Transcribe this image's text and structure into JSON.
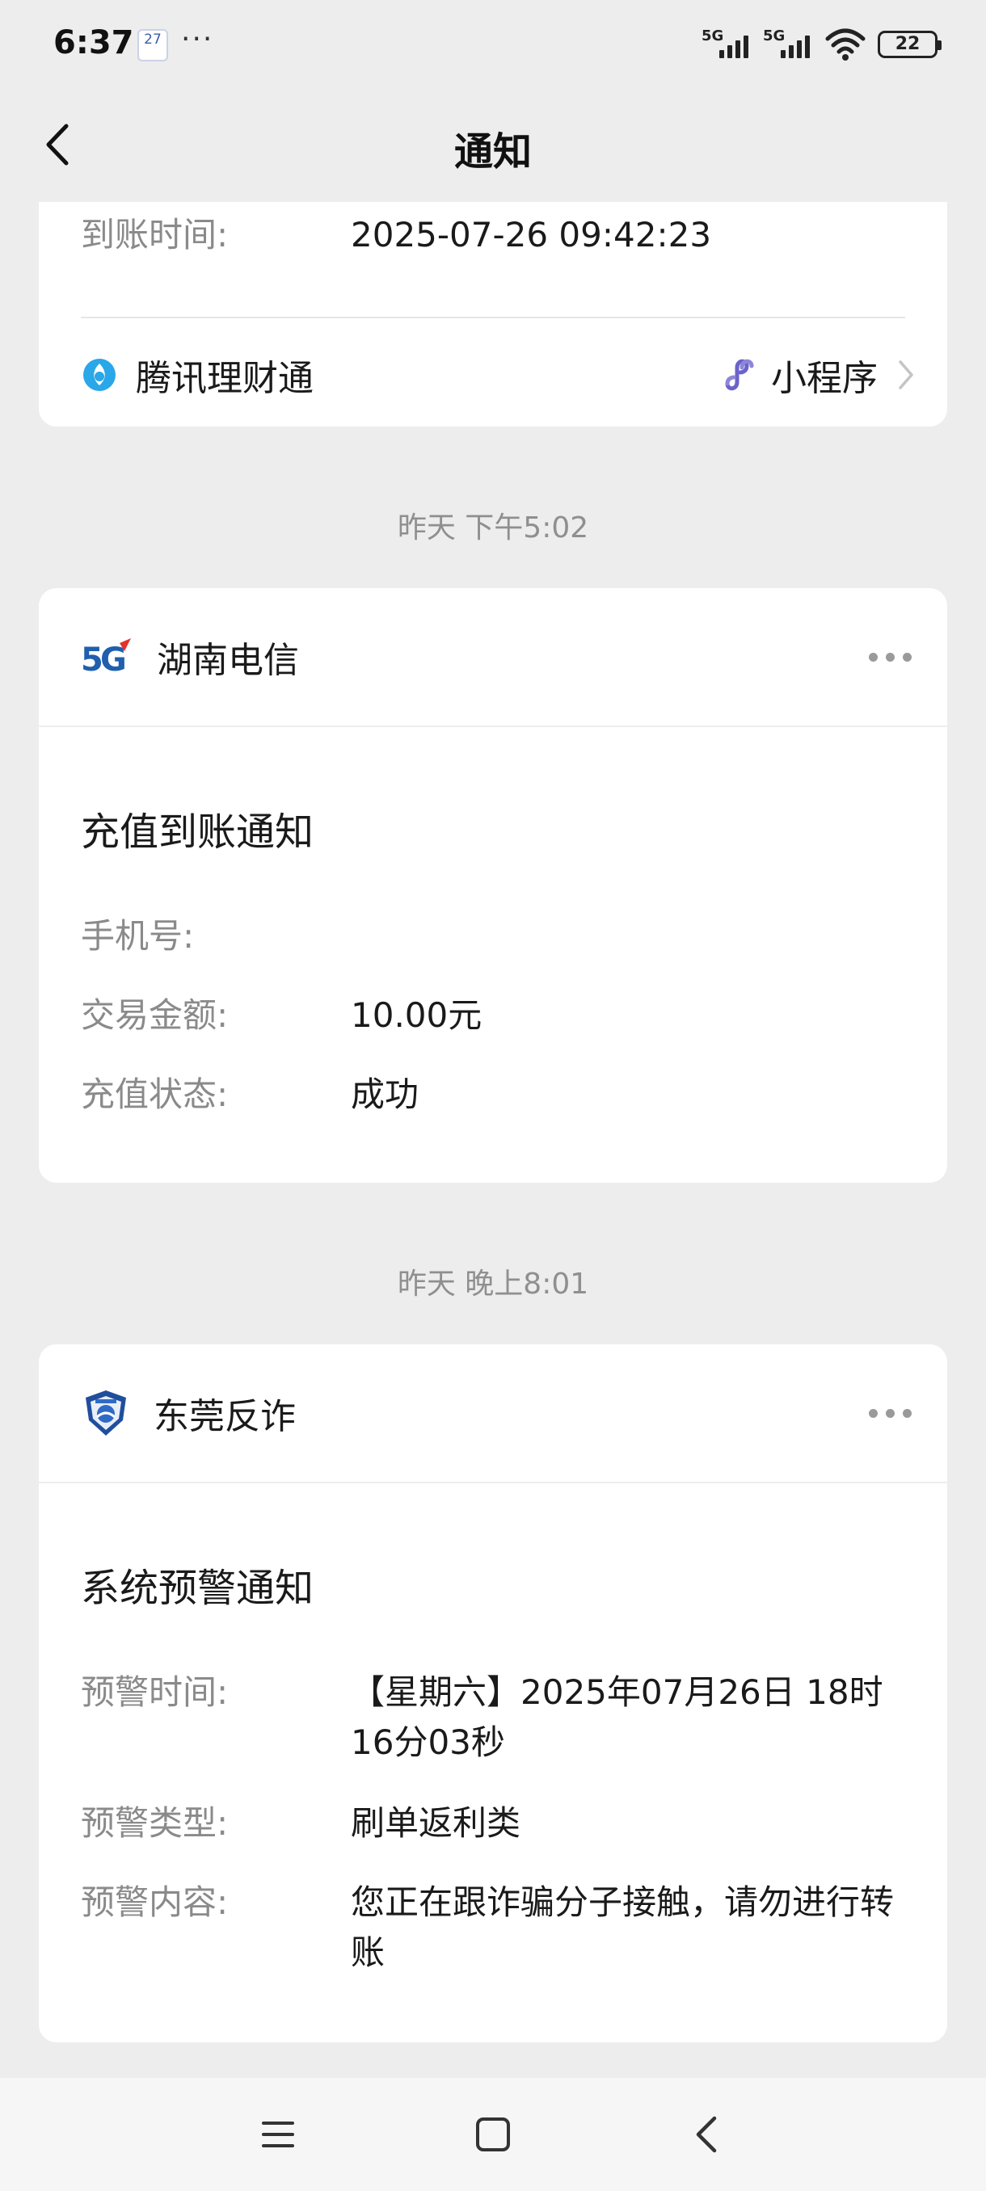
{
  "status_bar": {
    "time": "6:37",
    "calendar_day": "27",
    "more": "···",
    "signal1_label": "5G",
    "signal2_label": "5G",
    "battery": "22"
  },
  "nav": {
    "title": "通知"
  },
  "card_licaitong": {
    "arrival_label": "到账时间:",
    "arrival_value": "2025-07-26 09:42:23",
    "source_name": "腾讯理财通",
    "mini_program_label": "小程序"
  },
  "timestamp_1": "昨天 下午5:02",
  "card_telecom": {
    "account_name": "湖南电信",
    "title": "充值到账通知",
    "rows": [
      {
        "label": "手机号:",
        "value": ""
      },
      {
        "label": "交易金额:",
        "value": "10.00元"
      },
      {
        "label": "充值状态:",
        "value": "成功"
      }
    ]
  },
  "timestamp_2": "昨天 晚上8:01",
  "card_police": {
    "account_name": "东莞反诈",
    "title": "系统预警通知",
    "rows": [
      {
        "label": "预警时间:",
        "value": "【星期六】2025年07月26日 18时16分03秒"
      },
      {
        "label": "预警类型:",
        "value": "刷单返利类"
      },
      {
        "label": "预警内容:",
        "value": "您正在跟诈骗分子接触，请勿进行转账"
      }
    ]
  },
  "colors": {
    "background": "#ededed",
    "card": "#ffffff",
    "label_gray": "#8a8a8a",
    "telecom_blue": "#1f5fae",
    "telecom_red": "#e2322b",
    "mini_program_purple": "#6a63c9"
  }
}
